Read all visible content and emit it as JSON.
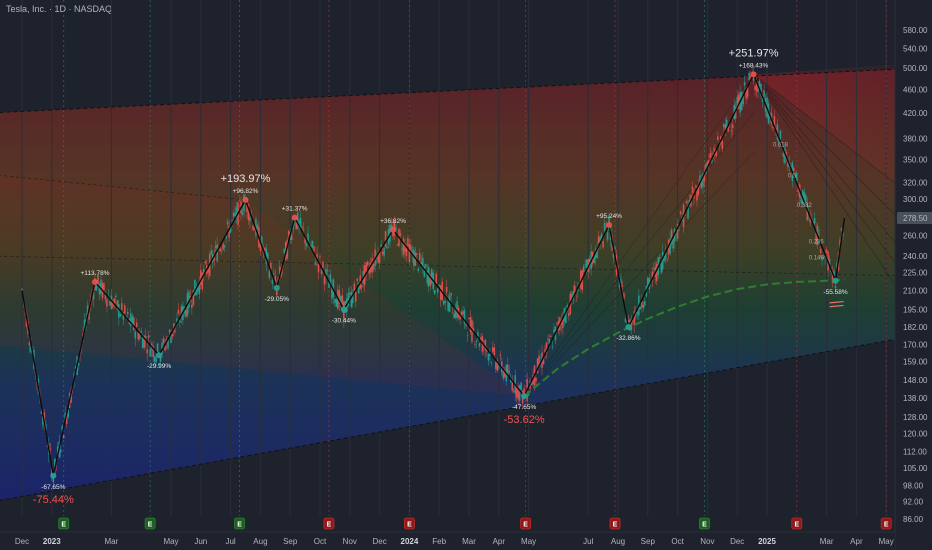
{
  "header": {
    "title": "Tesla, Inc. · 1D · NASDAQ"
  },
  "colors": {
    "background": "#1e222d",
    "up_candle": "#26a69a",
    "down_candle": "#ef5350",
    "zigzag": "#0b0b0b",
    "current_price_bg": "#4a4f5c",
    "ma_line": "#2e7d32",
    "earnings_green": "#1b5e20",
    "earnings_red": "#8b1a1a"
  },
  "chart_data": {
    "type": "candlestick",
    "title": "Tesla, Inc. · 1D · NASDAQ",
    "y_scale": "log",
    "ylim": [
      84,
      585
    ],
    "y_ticks": [
      580,
      540,
      500,
      460,
      420,
      380,
      350,
      320,
      300,
      280,
      260,
      240,
      225,
      210,
      195,
      182,
      170,
      159,
      148,
      138,
      128,
      120,
      112,
      105,
      98,
      92,
      86
    ],
    "x_ticks": [
      {
        "label": "Dec",
        "bold": false,
        "x": 0
      },
      {
        "label": "2023",
        "bold": true,
        "x": 1
      },
      {
        "label": "Mar",
        "bold": false,
        "x": 3
      },
      {
        "label": "May",
        "bold": false,
        "x": 5
      },
      {
        "label": "Jun",
        "bold": false,
        "x": 6
      },
      {
        "label": "Jul",
        "bold": false,
        "x": 7
      },
      {
        "label": "Aug",
        "bold": false,
        "x": 8
      },
      {
        "label": "Sep",
        "bold": false,
        "x": 9
      },
      {
        "label": "Oct",
        "bold": false,
        "x": 10
      },
      {
        "label": "Nov",
        "bold": false,
        "x": 11
      },
      {
        "label": "Dec",
        "bold": false,
        "x": 12
      },
      {
        "label": "2024",
        "bold": true,
        "x": 13
      },
      {
        "label": "Feb",
        "bold": false,
        "x": 14
      },
      {
        "label": "Mar",
        "bold": false,
        "x": 15
      },
      {
        "label": "Apr",
        "bold": false,
        "x": 16
      },
      {
        "label": "May",
        "bold": false,
        "x": 17
      },
      {
        "label": "Jul",
        "bold": false,
        "x": 19
      },
      {
        "label": "Aug",
        "bold": false,
        "x": 20
      },
      {
        "label": "Sep",
        "bold": false,
        "x": 21
      },
      {
        "label": "Oct",
        "bold": false,
        "x": 22
      },
      {
        "label": "Nov",
        "bold": false,
        "x": 23
      },
      {
        "label": "Dec",
        "bold": false,
        "x": 24
      },
      {
        "label": "2025",
        "bold": true,
        "x": 25
      },
      {
        "label": "Mar",
        "bold": false,
        "x": 27
      },
      {
        "label": "Apr",
        "bold": false,
        "x": 28
      },
      {
        "label": "May",
        "bold": false,
        "x": 29
      }
    ],
    "current_price": "278.50",
    "pivots": [
      {
        "x": 0,
        "y": 210
      },
      {
        "x": 1.05,
        "y": 101.8,
        "labels": [
          {
            "text": "-67.65%",
            "size": "small",
            "color": "#e6e6e6",
            "pos": "below"
          },
          {
            "text": "-75.44%",
            "size": "big",
            "color": "#ef5350",
            "pos": "below2"
          }
        ]
      },
      {
        "x": 2.45,
        "y": 217,
        "labels": [
          {
            "text": "+113.78%",
            "size": "small",
            "color": "#e6e6e6",
            "pos": "above"
          }
        ]
      },
      {
        "x": 4.6,
        "y": 163,
        "labels": [
          {
            "text": "-29.99%",
            "size": "small",
            "color": "#e6e6e6",
            "pos": "below"
          }
        ]
      },
      {
        "x": 7.5,
        "y": 299,
        "labels": [
          {
            "text": "+96.82%",
            "size": "small",
            "color": "#e6e6e6",
            "pos": "above"
          },
          {
            "text": "+193.97%",
            "size": "big",
            "color": "#e6e6e6",
            "pos": "above2"
          }
        ]
      },
      {
        "x": 8.55,
        "y": 212,
        "labels": [
          {
            "text": "-29.05%",
            "size": "small",
            "color": "#e6e6e6",
            "pos": "below"
          }
        ]
      },
      {
        "x": 9.15,
        "y": 279,
        "labels": [
          {
            "text": "+31.37%",
            "size": "small",
            "color": "#e6e6e6",
            "pos": "above"
          }
        ]
      },
      {
        "x": 10.8,
        "y": 195,
        "labels": [
          {
            "text": "-30.44%",
            "size": "small",
            "color": "#e6e6e6",
            "pos": "below"
          }
        ]
      },
      {
        "x": 12.45,
        "y": 266,
        "labels": [
          {
            "text": "+36.82%",
            "size": "small",
            "color": "#e6e6e6",
            "pos": "above"
          }
        ]
      },
      {
        "x": 16.85,
        "y": 139,
        "labels": [
          {
            "text": "-47.65%",
            "size": "small",
            "color": "#e6e6e6",
            "pos": "below"
          },
          {
            "text": "-53.62%",
            "size": "big",
            "color": "#ef5350",
            "pos": "below2"
          }
        ]
      },
      {
        "x": 19.7,
        "y": 271,
        "labels": [
          {
            "text": "+95.24%",
            "size": "small",
            "color": "#e6e6e6",
            "pos": "above"
          }
        ]
      },
      {
        "x": 20.35,
        "y": 182,
        "labels": [
          {
            "text": "-32.86%",
            "size": "small",
            "color": "#e6e6e6",
            "pos": "below"
          }
        ]
      },
      {
        "x": 24.55,
        "y": 488,
        "labels": [
          {
            "text": "+168.43%",
            "size": "small",
            "color": "#e6e6e6",
            "pos": "above"
          },
          {
            "text": "+251.97%",
            "size": "big",
            "color": "#e6e6e6",
            "pos": "above2"
          }
        ]
      },
      {
        "x": 27.3,
        "y": 218,
        "labels": [
          {
            "text": "-55.58%",
            "size": "small",
            "color": "#ef5350",
            "pos": "below"
          }
        ]
      },
      {
        "x": 27.6,
        "y": 278.5
      }
    ],
    "fib_labels": [
      {
        "text": "0.618",
        "x": 25.2,
        "y": 368
      },
      {
        "text": "0.5",
        "x": 25.7,
        "y": 326
      },
      {
        "text": "0.382",
        "x": 26.0,
        "y": 291
      },
      {
        "text": "0.236",
        "x": 26.4,
        "y": 252
      },
      {
        "text": "0.146",
        "x": 26.4,
        "y": 237
      }
    ],
    "earnings": [
      {
        "x": 1.4,
        "type": "green"
      },
      {
        "x": 4.3,
        "type": "green"
      },
      {
        "x": 7.3,
        "type": "green"
      },
      {
        "x": 10.3,
        "type": "red"
      },
      {
        "x": 13.0,
        "type": "red"
      },
      {
        "x": 16.9,
        "type": "red"
      },
      {
        "x": 19.9,
        "type": "red"
      },
      {
        "x": 22.9,
        "type": "green"
      },
      {
        "x": 26.0,
        "type": "red"
      },
      {
        "x": 29.0,
        "type": "red"
      }
    ],
    "ma_curve": [
      {
        "x": 16.85,
        "y": 139
      },
      {
        "x": 18.0,
        "y": 155
      },
      {
        "x": 19.0,
        "y": 167
      },
      {
        "x": 20.0,
        "y": 178
      },
      {
        "x": 21.0,
        "y": 188
      },
      {
        "x": 22.0,
        "y": 197
      },
      {
        "x": 23.0,
        "y": 205
      },
      {
        "x": 24.0,
        "y": 211
      },
      {
        "x": 25.0,
        "y": 215
      },
      {
        "x": 26.0,
        "y": 217
      },
      {
        "x": 27.0,
        "y": 218
      },
      {
        "x": 27.6,
        "y": 219
      }
    ],
    "channel": {
      "upper": [
        {
          "x": -1,
          "y": 420
        },
        {
          "x": 30,
          "y": 500
        }
      ],
      "lower": [
        {
          "x": -1,
          "y": 92
        },
        {
          "x": 30,
          "y": 176
        }
      ],
      "mid_lines": [
        {
          "from": {
            "x": -1,
            "y": 330
          },
          "to": {
            "x": 7.5,
            "y": 299
          }
        },
        {
          "from": {
            "x": -1,
            "y": 240
          },
          "to": {
            "x": 30,
            "y": 222
          }
        }
      ]
    }
  }
}
